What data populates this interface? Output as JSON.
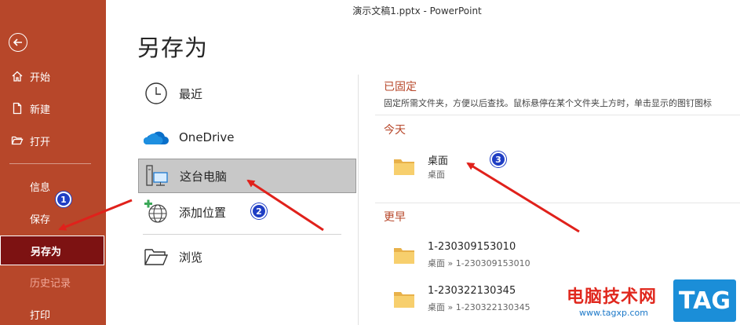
{
  "window": {
    "title": "演示文稿1.pptx  -  PowerPoint"
  },
  "sidebar": {
    "items": [
      {
        "label": "开始"
      },
      {
        "label": "新建"
      },
      {
        "label": "打开"
      },
      {
        "label": "信息"
      },
      {
        "label": "保存"
      },
      {
        "label": "另存为"
      },
      {
        "label": "历史记录"
      },
      {
        "label": "打印"
      }
    ]
  },
  "main": {
    "title": "另存为",
    "locations": [
      {
        "label": "最近"
      },
      {
        "label": "OneDrive"
      },
      {
        "label": "这台电脑"
      },
      {
        "label": "添加位置"
      },
      {
        "label": "浏览"
      }
    ]
  },
  "right": {
    "pinned_header": "已固定",
    "pinned_desc": "固定所需文件夹，方便以后查找。鼠标悬停在某个文件夹上方时，单击显示的图钉图标",
    "today_header": "今天",
    "earlier_header": "更早",
    "today_folders": [
      {
        "name": "桌面",
        "path": "桌面"
      }
    ],
    "earlier_folders": [
      {
        "name": "1-230309153010",
        "path": "桌面 » 1-230309153010"
      },
      {
        "name": "1-230322130345",
        "path": "桌面 » 1-230322130345"
      }
    ]
  },
  "annotations": {
    "badge1": "1",
    "badge2": "2",
    "badge3": "3"
  },
  "watermark": {
    "text": "电脑技术网",
    "url": "www.tagxp.com",
    "tag": "TAG"
  },
  "colors": {
    "accent": "#b7472a",
    "active_item": "#7d1212",
    "badge": "#1f3ec4",
    "arrow": "#e0211b",
    "selected_location": "#c8c8c8"
  }
}
